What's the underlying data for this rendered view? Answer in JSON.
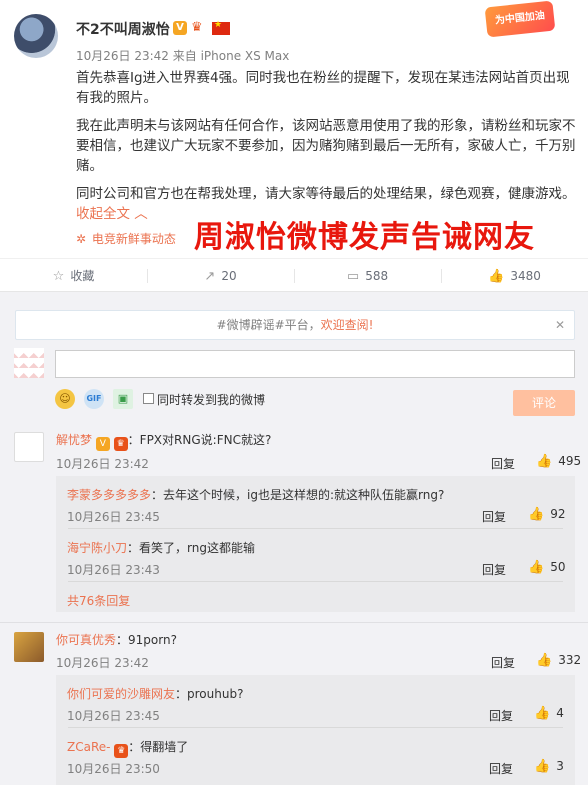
{
  "post": {
    "username": "不2不叫周淑怡",
    "verified_badge": "V",
    "meta": "10月26日 23:42 来自 iPhone XS Max",
    "promo_badge": "为中国加油",
    "paragraph1": "首先恭喜Ig进入世界赛4强。同时我也在粉丝的提醒下，发现在某违法网站首页出现有我的照片。",
    "paragraph2": "我在此声明未与该网站有任何合作，该网站恶意用使用了我的形象，请粉丝和玩家不要相信，也建议广大玩家不要参加，因为赌狗赌到最后一无所有，家破人亡，千万别赌。",
    "paragraph3": "同时公司和官方也在帮我处理，请大家等待最后的处理结果，绿色观赛，健康游戏。",
    "collapse_label": "收起全文 ︿",
    "source": "电竞新鲜事动态",
    "overlay_title": "周淑怡微博发声告诫网友"
  },
  "actions": {
    "favorite": "收藏",
    "forward": "20",
    "comment": "588",
    "like": "3480"
  },
  "compose": {
    "notice_prefix": "#微博辟谣#平台，",
    "notice_link": "欢迎查阅!",
    "forward_label": "同时转发到我的微博",
    "submit_label": "评论"
  },
  "comments": [
    {
      "name": "解忧梦",
      "text": "：FPX对RNG说:FNC就这?",
      "time": "10月26日 23:42",
      "reply": "回复",
      "likes": "495",
      "replies": [
        {
          "name": "李蒙多多多多多",
          "text": "：去年这个时候，ig也是这样想的:就这种队伍能赢rng?",
          "time": "10月26日 23:45",
          "reply": "回复",
          "likes": "92"
        },
        {
          "name": "海宁陈小刀",
          "text": "：看笑了，rng这都能输",
          "time": "10月26日 23:43",
          "reply": "回复",
          "likes": "50"
        }
      ],
      "more": "共76条回复"
    },
    {
      "name": "你可真优秀",
      "text": "：91porn?",
      "time": "10月26日 23:42",
      "reply": "回复",
      "likes": "332",
      "replies": [
        {
          "name": "你们可爱的沙雕网友",
          "text": "：prouhub?",
          "time": "10月26日 23:45",
          "reply": "回复",
          "likes": "4"
        },
        {
          "name": "ZCaRe-",
          "text": "：得翻墙了",
          "time": "10月26日 23:50",
          "reply": "回复",
          "likes": "3"
        }
      ]
    }
  ]
}
